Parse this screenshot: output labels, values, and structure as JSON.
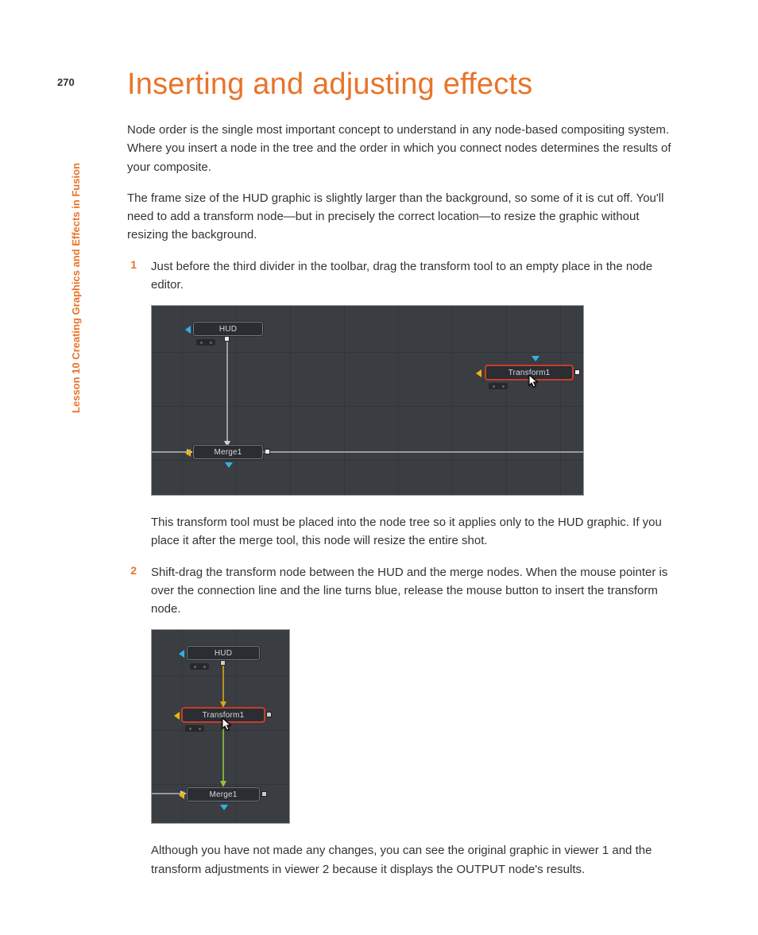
{
  "page_number": "270",
  "sidebar_text": "Lesson 10    Creating Graphics and Effects in Fusion",
  "title": "Inserting and adjusting effects",
  "intro1": "Node order is the single most important concept to understand in any node-based compositing system. Where you insert a node in the tree and the order in which you connect nodes determines the results of your composite.",
  "intro2": "The frame size of the HUD graphic is slightly larger than the background, so some of it is cut off. You'll need to add a transform node—but in precisely the correct location—to resize the graphic without resizing the background.",
  "steps": [
    {
      "num": "1",
      "text": "Just before the third divider in the toolbar, drag the transform tool to an empty place in the node editor."
    },
    {
      "num": "2",
      "text": "Shift-drag the transform node between the HUD and the merge nodes. When the mouse pointer is over the connection line and the line turns blue, release the mouse button to insert the transform node."
    }
  ],
  "after_step1": "This transform tool must be placed into the node tree so it applies only to the HUD graphic. If you place it after the merge tool, this node will resize the entire shot.",
  "after_step2": "Although you have not made any changes, you can see the original graphic in viewer 1 and the transform adjustments in viewer 2 because it displays the OUTPUT node's results.",
  "nodes": {
    "hud": "HUD",
    "merge": "Merge1",
    "transform": "Transform1"
  },
  "colors": {
    "accent": "#E8742A",
    "editor_bg": "#3a3d42",
    "node_bg": "#2a2d32"
  }
}
